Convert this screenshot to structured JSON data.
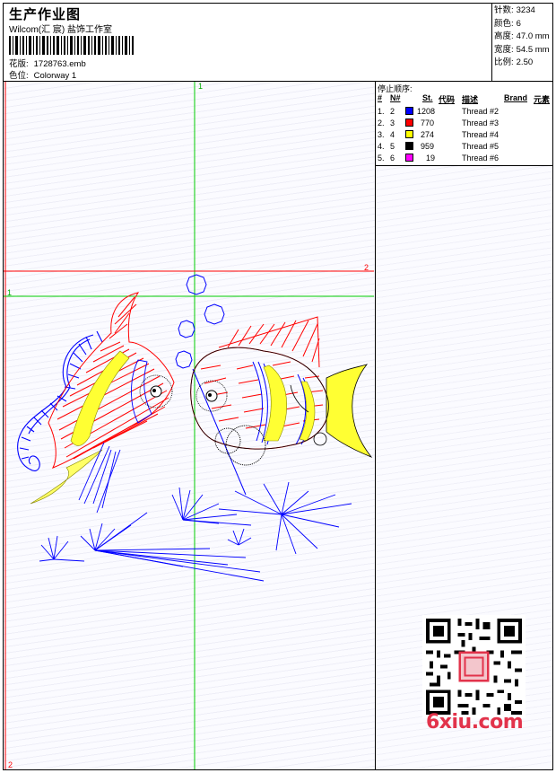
{
  "header": {
    "title": "生产作业图",
    "software": "Wilcom(汇 宸) 盐饰工作室",
    "design_label": "花版:",
    "design_file": "1728763.emb",
    "colorway_label": "色位:",
    "colorway": "Colorway 1"
  },
  "specs": [
    {
      "label": "针数:",
      "value": "3234"
    },
    {
      "label": "颜色:",
      "value": "6"
    },
    {
      "label": "高度:",
      "value": "47.0 mm"
    },
    {
      "label": "宽度:",
      "value": "54.5 mm"
    },
    {
      "label": "比例:",
      "value": "2.50"
    }
  ],
  "stop_sequence": {
    "title": "停止顺序:",
    "columns": [
      "#",
      "N#",
      "St.",
      "代码",
      "描述",
      "Brand",
      "元素"
    ],
    "rows": [
      {
        "num": "1.",
        "needle": "2",
        "color": "#0000ff",
        "stitches": "1208",
        "desc": "Thread #2"
      },
      {
        "num": "2.",
        "needle": "3",
        "color": "#ff0000",
        "stitches": "770",
        "desc": "Thread #3"
      },
      {
        "num": "3.",
        "needle": "4",
        "color": "#ffff00",
        "stitches": "274",
        "desc": "Thread #4"
      },
      {
        "num": "4.",
        "needle": "5",
        "color": "#000000",
        "stitches": "959",
        "desc": "Thread #5"
      },
      {
        "num": "5.",
        "needle": "6",
        "color": "#ff00ff",
        "stitches": "19",
        "desc": "Thread #6"
      }
    ]
  },
  "guides": {
    "v1_label": "1",
    "h2_label": "2",
    "h1_label": "1",
    "v2_label": "2"
  },
  "watermark": "6xiu.com",
  "colors": {
    "guide_green": "#00cc00",
    "guide_red": "#ff0000",
    "thread_blue": "#0000ff",
    "thread_red": "#ff0000",
    "thread_yellow": "#ffff00",
    "thread_black": "#000000"
  }
}
